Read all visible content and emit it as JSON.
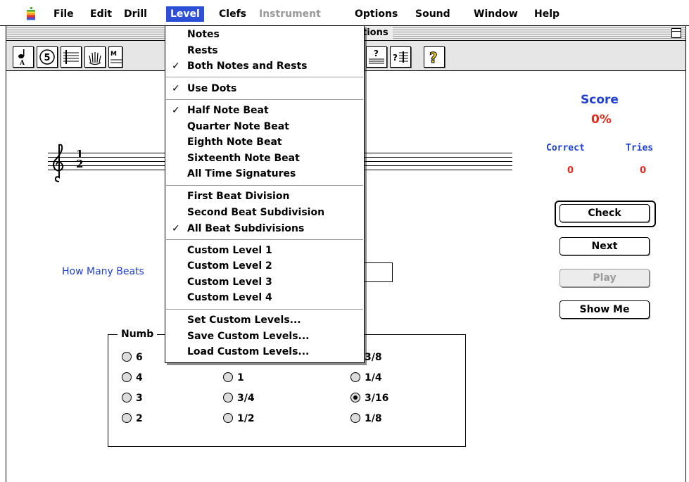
{
  "menubar": {
    "items": [
      {
        "label": "File"
      },
      {
        "label": "Edit"
      },
      {
        "label": "Drill"
      },
      {
        "label": "Level"
      },
      {
        "label": "Clefs"
      },
      {
        "label": "Instrument"
      },
      {
        "label": "Options"
      },
      {
        "label": "Sound"
      },
      {
        "label": "Window"
      },
      {
        "label": "Help"
      }
    ]
  },
  "window": {
    "title_fragment": "tions"
  },
  "toolbar": {
    "tools": [
      {
        "icon": "quarter-note-icon",
        "glyph": "♩"
      },
      {
        "icon": "number-5-icon",
        "glyph": "⑤"
      },
      {
        "icon": "staff-notes-icon",
        "glyph": "≡"
      },
      {
        "icon": "hand-icon",
        "glyph": "✋"
      },
      {
        "icon": "help-question-icon",
        "glyph": "?"
      }
    ]
  },
  "question": {
    "text": "How Many Beats"
  },
  "score": {
    "title": "Score",
    "percent": "0%",
    "correct_label": "Correct",
    "tries_label": "Tries",
    "correct": "0",
    "tries": "0"
  },
  "buttons": {
    "check": "Check",
    "next": "Next",
    "play": "Play",
    "show_me": "Show Me"
  },
  "answers": {
    "group_label": "Numb",
    "col1": [
      {
        "label": "6"
      },
      {
        "label": "4"
      },
      {
        "label": "3"
      },
      {
        "label": "2"
      }
    ],
    "col2": [
      {
        "label": "1"
      },
      {
        "label": "3/4"
      },
      {
        "label": "1/2"
      }
    ],
    "col3": [
      {
        "label": "3/8"
      },
      {
        "label": "1/4"
      },
      {
        "label": "3/16",
        "selected": true
      },
      {
        "label": "1/8"
      }
    ]
  },
  "level_menu": {
    "items": [
      {
        "label": "Notes",
        "checked": false
      },
      {
        "label": "Rests",
        "checked": false
      },
      {
        "label": "Both Notes and Rests",
        "checked": true
      },
      {
        "label": "Use Dots",
        "checked": true
      },
      {
        "label": "Half Note Beat",
        "checked": true
      },
      {
        "label": "Quarter Note Beat",
        "checked": false
      },
      {
        "label": "Eighth Note Beat",
        "checked": false
      },
      {
        "label": "Sixteenth Note Beat",
        "checked": false
      },
      {
        "label": "All Time Signatures",
        "checked": false
      },
      {
        "label": "First Beat Division",
        "checked": false
      },
      {
        "label": "Second Beat Subdivision",
        "checked": false
      },
      {
        "label": "All Beat Subdivisions",
        "checked": true
      },
      {
        "label": "Custom Level  1",
        "checked": false
      },
      {
        "label": "Custom Level  2",
        "checked": false
      },
      {
        "label": "Custom Level  3",
        "checked": false
      },
      {
        "label": "Custom Level  4",
        "checked": false
      },
      {
        "label": "Set Custom Levels...",
        "checked": false
      },
      {
        "label": "Save Custom Levels...",
        "checked": false
      },
      {
        "label": "Load Custom Levels...",
        "checked": false
      }
    ],
    "checkmark": "✓"
  },
  "colors": {
    "menu_highlight": "#2d50d6",
    "score_blue": "#1f3fcf",
    "score_red": "#e52a1f"
  }
}
